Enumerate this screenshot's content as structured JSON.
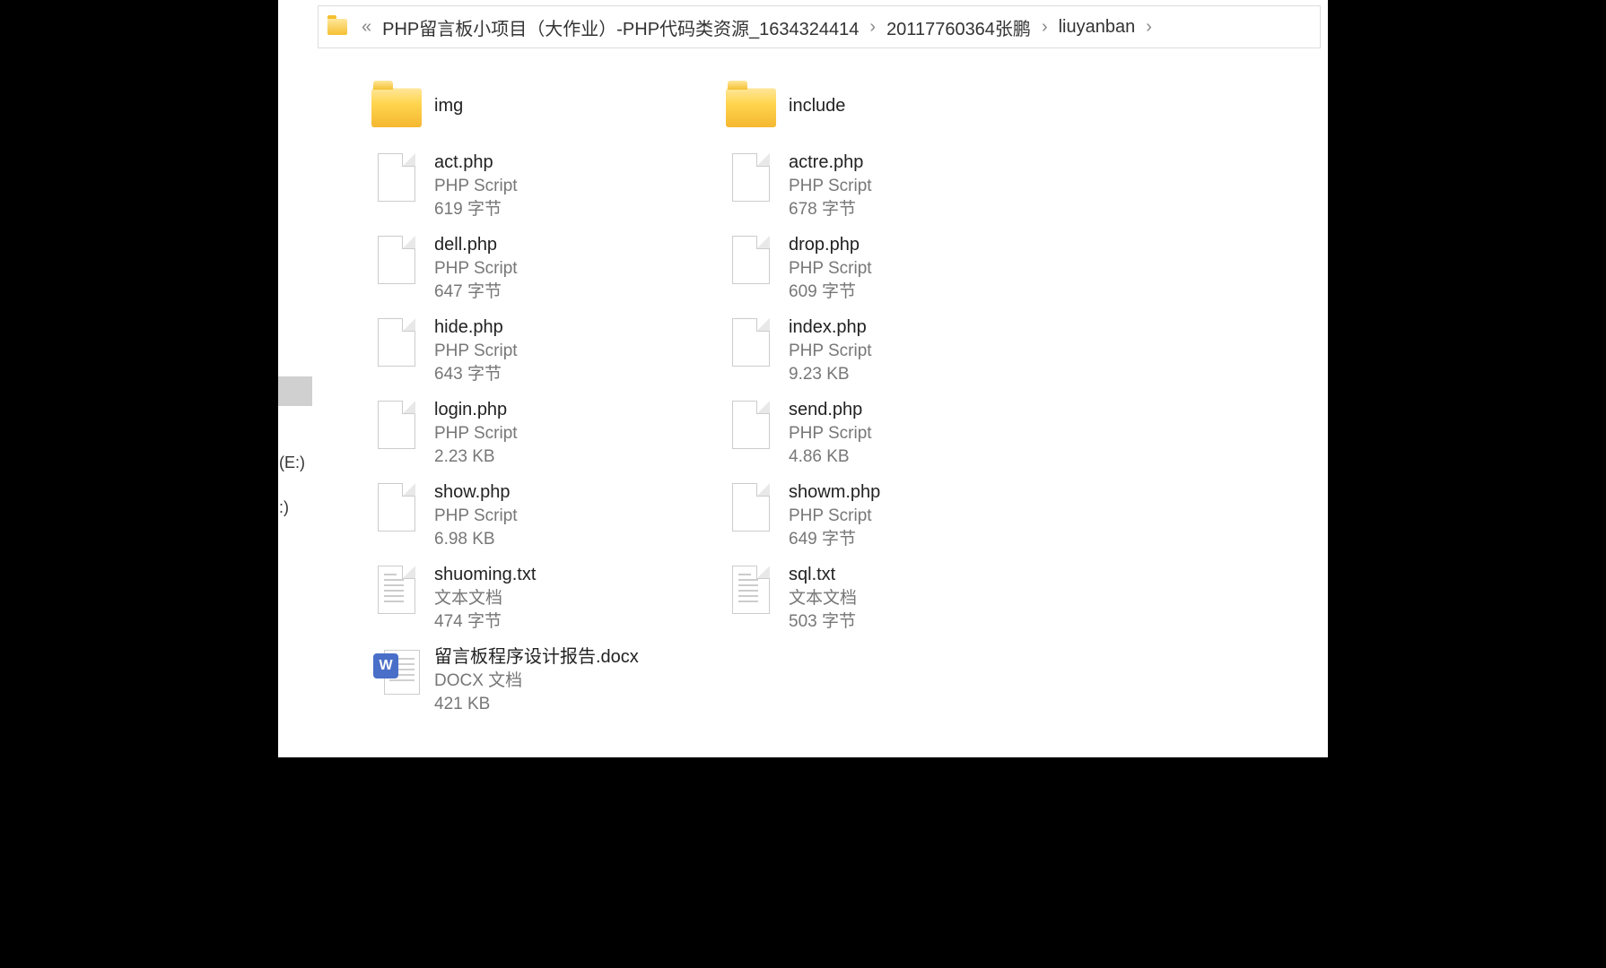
{
  "breadcrumb": {
    "overflow": "«",
    "sep": "›",
    "items": [
      "PHP留言板小项目（大作业）-PHP代码类资源_1634324414",
      "20117760364张鹏",
      "liuyanban"
    ]
  },
  "sidebar": {
    "drive_e": "(E:)",
    "drive_other": ":)"
  },
  "items": [
    {
      "kind": "folder",
      "name": "img"
    },
    {
      "kind": "folder",
      "name": "include"
    },
    {
      "kind": "php",
      "name": "act.php",
      "type": "PHP Script",
      "size": "619 字节"
    },
    {
      "kind": "php",
      "name": "actre.php",
      "type": "PHP Script",
      "size": "678 字节"
    },
    {
      "kind": "php",
      "name": "dell.php",
      "type": "PHP Script",
      "size": "647 字节"
    },
    {
      "kind": "php",
      "name": "drop.php",
      "type": "PHP Script",
      "size": "609 字节"
    },
    {
      "kind": "php",
      "name": "hide.php",
      "type": "PHP Script",
      "size": "643 字节"
    },
    {
      "kind": "php",
      "name": "index.php",
      "type": "PHP Script",
      "size": "9.23 KB"
    },
    {
      "kind": "php",
      "name": "login.php",
      "type": "PHP Script",
      "size": "2.23 KB"
    },
    {
      "kind": "php",
      "name": "send.php",
      "type": "PHP Script",
      "size": "4.86 KB"
    },
    {
      "kind": "php",
      "name": "show.php",
      "type": "PHP Script",
      "size": "6.98 KB"
    },
    {
      "kind": "php",
      "name": "showm.php",
      "type": "PHP Script",
      "size": "649 字节"
    },
    {
      "kind": "txt",
      "name": "shuoming.txt",
      "type": "文本文档",
      "size": "474 字节"
    },
    {
      "kind": "txt",
      "name": "sql.txt",
      "type": "文本文档",
      "size": "503 字节"
    },
    {
      "kind": "docx",
      "name": "留言板程序设计报告.docx",
      "type": "DOCX 文档",
      "size": "421 KB"
    }
  ],
  "docx_badge": "W"
}
